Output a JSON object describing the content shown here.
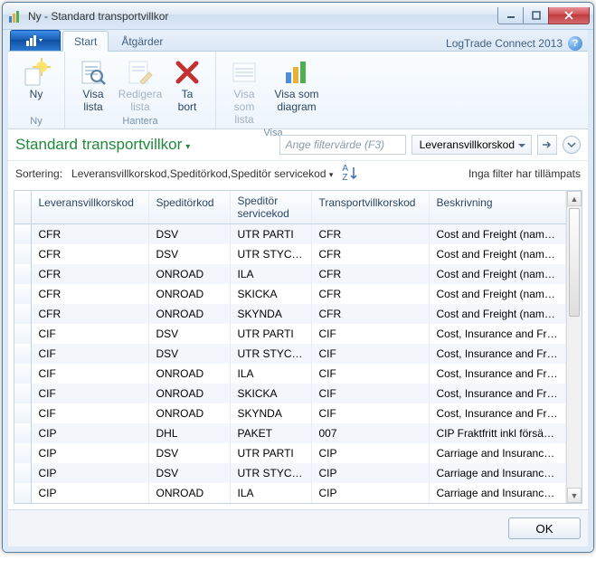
{
  "window": {
    "title": "Ny - Standard transportvillkor"
  },
  "tabs": {
    "start": "Start",
    "actions": "Åtgärder",
    "brand": "LogTrade Connect 2013"
  },
  "ribbon": {
    "ny_group": "Ny",
    "hantera_group": "Hantera",
    "visa_group": "Visa",
    "btn_ny": "Ny",
    "btn_visa_lista": "Visa\nlista",
    "btn_redigera_lista": "Redigera\nlista",
    "btn_ta_bort": "Ta\nbort",
    "btn_visa_som_lista": "Visa\nsom lista",
    "btn_visa_som_diagram": "Visa som\ndiagram"
  },
  "page": {
    "title": "Standard transportvillkor",
    "filter_placeholder": "Ange filtervärde (F3)",
    "filter_field": "Leveransvillkorskod",
    "sort_label": "Sortering:",
    "sort_value": "Leveransvillkorskod,Speditörkod,Speditör servicekod",
    "filters_status": "Inga filter har tillämpats"
  },
  "columns": {
    "c1": "Leveransvillkorskod",
    "c2": "Speditörkod",
    "c3": "Speditör\nservicekod",
    "c4": "Transportvillkorskod",
    "c5": "Beskrivning"
  },
  "rows": [
    {
      "c1": "CFR",
      "c2": "DSV",
      "c3": "UTR PARTI",
      "c4": "CFR",
      "c5": "Cost and Freight (name..."
    },
    {
      "c1": "CFR",
      "c2": "DSV",
      "c3": "UTR STYCKE",
      "c4": "CFR",
      "c5": "Cost and Freight (name..."
    },
    {
      "c1": "CFR",
      "c2": "ONROAD",
      "c3": "ILA",
      "c4": "CFR",
      "c5": "Cost and Freight (name..."
    },
    {
      "c1": "CFR",
      "c2": "ONROAD",
      "c3": "SKICKA",
      "c4": "CFR",
      "c5": "Cost and Freight (name..."
    },
    {
      "c1": "CFR",
      "c2": "ONROAD",
      "c3": "SKYNDA",
      "c4": "CFR",
      "c5": "Cost and Freight (name..."
    },
    {
      "c1": "CIF",
      "c2": "DSV",
      "c3": "UTR PARTI",
      "c4": "CIF",
      "c5": "Cost, Insurance and Frei..."
    },
    {
      "c1": "CIF",
      "c2": "DSV",
      "c3": "UTR STYCKE",
      "c4": "CIF",
      "c5": "Cost, Insurance and Frei..."
    },
    {
      "c1": "CIF",
      "c2": "ONROAD",
      "c3": "ILA",
      "c4": "CIF",
      "c5": "Cost, Insurance and Frei..."
    },
    {
      "c1": "CIF",
      "c2": "ONROAD",
      "c3": "SKICKA",
      "c4": "CIF",
      "c5": "Cost, Insurance and Frei..."
    },
    {
      "c1": "CIF",
      "c2": "ONROAD",
      "c3": "SKYNDA",
      "c4": "CIF",
      "c5": "Cost, Insurance and Frei..."
    },
    {
      "c1": "CIP",
      "c2": "DHL",
      "c3": "PAKET",
      "c4": "007",
      "c5": "CIP Fraktfritt inkl försäkr..."
    },
    {
      "c1": "CIP",
      "c2": "DSV",
      "c3": "UTR PARTI",
      "c4": "CIP",
      "c5": "Carriage and Insurance ..."
    },
    {
      "c1": "CIP",
      "c2": "DSV",
      "c3": "UTR STYCKE",
      "c4": "CIP",
      "c5": "Carriage and Insurance ..."
    },
    {
      "c1": "CIP",
      "c2": "ONROAD",
      "c3": "ILA",
      "c4": "CIP",
      "c5": "Carriage and Insurance ..."
    }
  ],
  "footer": {
    "ok": "OK"
  }
}
